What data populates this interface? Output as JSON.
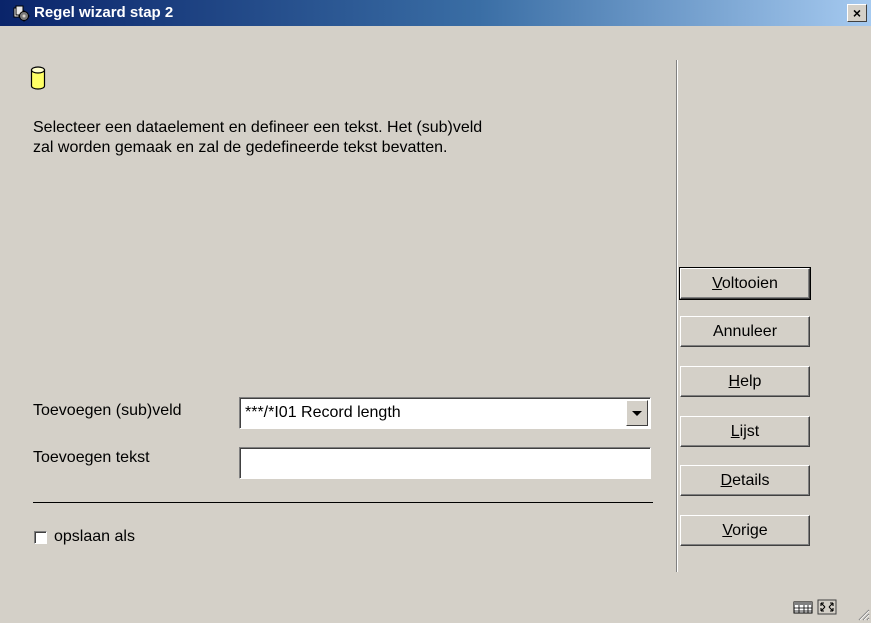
{
  "window": {
    "title": "Regel wizard stap 2",
    "close_label": "×"
  },
  "instruction": "Selecteer een dataelement en defineer een tekst. Het (sub)veld\nzal worden gemaak en zal de gedefineerde tekst bevatten.",
  "form": {
    "field_label": "Toevoegen (sub)veld",
    "field_value": "***/*I01 Record length",
    "text_label": "Toevoegen tekst",
    "text_value": "",
    "save_as_label": "opslaan als",
    "save_as_checked": false
  },
  "buttons": [
    {
      "name": "voltooien",
      "mnemonic": "V",
      "rest": "oltooien"
    },
    {
      "name": "annuleer",
      "mnemonic": "",
      "rest": "Annuleer"
    },
    {
      "name": "help",
      "mnemonic": "H",
      "rest": "elp"
    },
    {
      "name": "lijst",
      "mnemonic": "L",
      "rest": "ijst"
    },
    {
      "name": "details",
      "mnemonic": "D",
      "rest": "etails"
    },
    {
      "name": "vorige",
      "mnemonic": "V",
      "rest": "orige"
    }
  ],
  "colors": {
    "titlebar_start": "#0a246a",
    "titlebar_end": "#a6caf0",
    "background": "#d4d0c8"
  },
  "icons": [
    "app-icon",
    "database-icon",
    "close-icon",
    "grid-icon",
    "resize-icon",
    "size-grip-icon"
  ]
}
